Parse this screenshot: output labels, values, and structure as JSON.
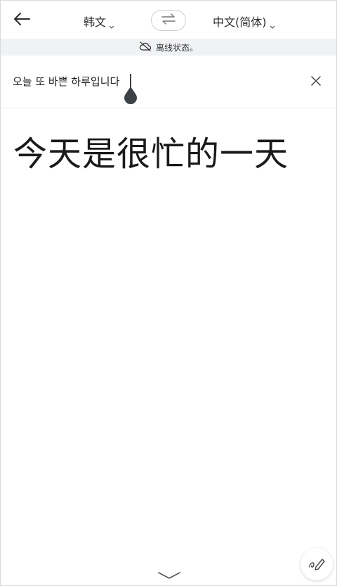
{
  "header": {
    "back_icon": "arrow-left-icon",
    "source_language": "韩文",
    "target_language": "中文(简体)",
    "swap_icon": "swap-arrows-icon"
  },
  "status": {
    "icon": "cloud-off-icon",
    "text": "离线状态。"
  },
  "input": {
    "value": "오늘 또 바쁜 하루입니다",
    "clear_icon": "close-icon"
  },
  "result": {
    "text": "今天是很忙的一天"
  },
  "controls": {
    "handwrite_icon": "handwriting-pen-icon",
    "collapse_icon": "chevron-down-icon"
  },
  "colors": {
    "status_bg": "#f1f2f4",
    "cursor": "#3c4148",
    "text": "#1f1f1f"
  }
}
